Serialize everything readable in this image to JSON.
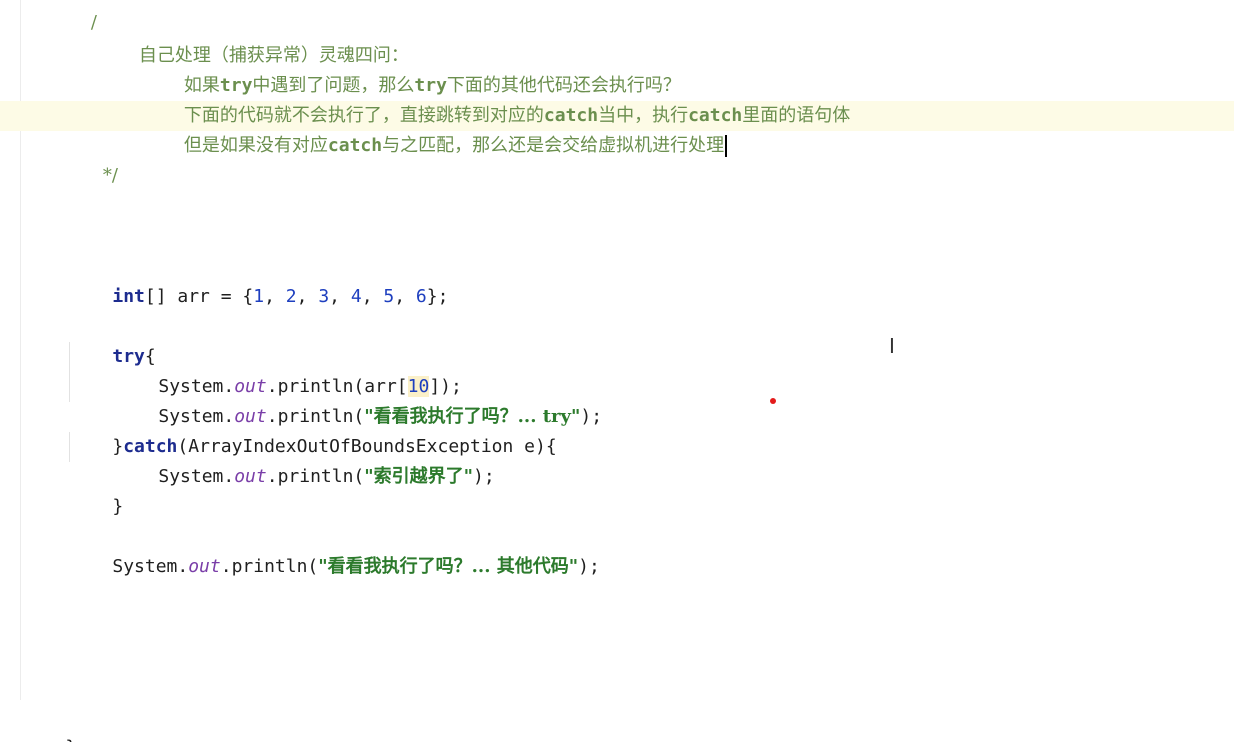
{
  "comment": {
    "title": "自己处理（捕获异常）灵魂四问：",
    "q_pre": "如果",
    "q_try1": "try",
    "q_mid": "中遇到了问题，那么",
    "q_try2": "try",
    "q_post": "下面的其他代码还会执行吗？",
    "a1_pre": "下面的代码就不会执行了，直接跳转到对应的",
    "a1_catch1": "catch",
    "a1_mid": "当中，执行",
    "a1_catch2": "catch",
    "a1_post": "里面的语句体",
    "a2_pre": "但是如果没有对应",
    "a2_catch": "catch",
    "a2_post": "与之匹配，那么还是会交给虚拟机进行处理",
    "close": "*/",
    "open_tail": "/"
  },
  "code": {
    "int_kw": "int",
    "arr_decl": "[] arr = {",
    "values": [
      "1",
      "2",
      "3",
      "4",
      "5",
      "6"
    ],
    "arr_end": "};",
    "try_kw": "try",
    "brace_open": "{",
    "system": "System.",
    "out": "out",
    "println_arr": ".println(arr[",
    "index": "10",
    "println_arr_end": "]);",
    "println_open": ".println(",
    "println_close": ");",
    "str_try": "\"看看我执行了吗？... try\"",
    "catch_close_brace": "}",
    "catch_kw": "catch",
    "catch_param": "(ArrayIndexOutOfBoundsException e){",
    "str_catch": "\"索引越界了\"",
    "close_brace": "}",
    "str_other": "\"看看我执行了吗？... 其他代码\"",
    "final_brace": "}"
  },
  "cursor_glyph": "I"
}
